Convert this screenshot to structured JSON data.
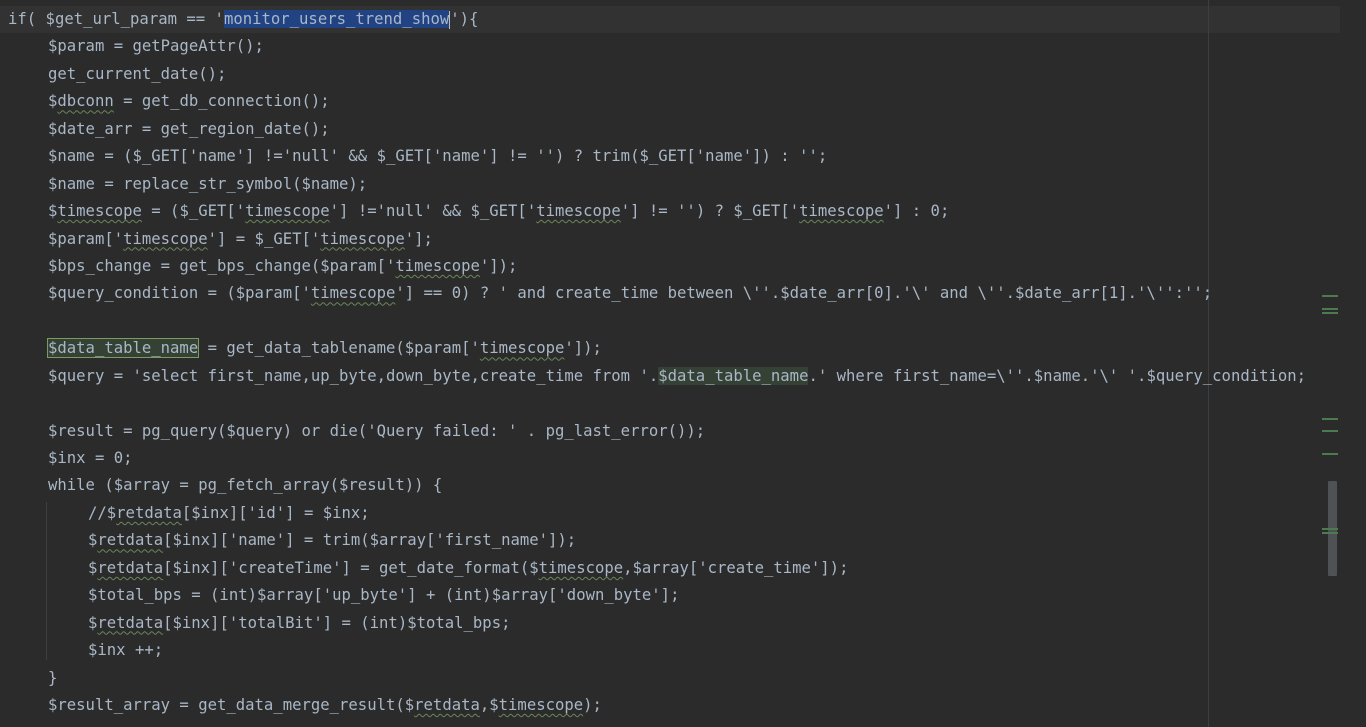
{
  "editor": {
    "lines": [
      {
        "pre": "if( $get_url_param == '",
        "selected": "monitor_users_trend_show",
        "post": "'){"
      },
      {
        "text": "$param = getPageAttr();"
      },
      {
        "text": "get_current_date();"
      },
      {
        "pre": "$",
        "squig": "dbconn",
        "post": " = get_db_connection();"
      },
      {
        "text": "$date_arr = get_region_date();"
      },
      {
        "text": "$name = ($_GET['name'] !='null' && $_GET['name'] != '') ? trim($_GET['name']) : '';"
      },
      {
        "text": "$name = replace_str_symbol($name);"
      },
      {
        "pre": "$",
        "squig": "timescope",
        "mid1": " = ($_GET['",
        "squig2": "timescope",
        "mid2": "'] !='null' && $_GET['",
        "squig3": "timescope",
        "mid3": "'] != '') ? $_GET['",
        "squig4": "timescope",
        "post": "'] : 0;"
      },
      {
        "pre": "$param['",
        "squig": "timescope",
        "mid1": "'] = $_GET['",
        "squig2": "timescope",
        "post": "'];"
      },
      {
        "pre": "$bps_change = get_bps_change($param['",
        "squig": "timescope",
        "post": "']);"
      },
      {
        "pre": "$query_condition = ($param['",
        "squig": "timescope",
        "post": "'] == 0) ? ' and create_time between \\''.$date_arr[0].'\\' and \\''.$date_arr[1].'\\'':'';"
      },
      {
        "text": ""
      },
      {
        "box": "$data_table_name",
        "pre": " = get_data_tablename($param['",
        "squig": "timescope",
        "post": "']);"
      },
      {
        "pre": "$query = 'select first_name,up_byte,down_byte,create_time from '.",
        "usage": "$data_table_name",
        "post": ".' where first_name=\\''.$name.'\\' '.$query_condition;"
      },
      {
        "text": ""
      },
      {
        "text": "$result = pg_query($query) or die('Query failed: ' . pg_last_error());"
      },
      {
        "text": "$inx = 0;"
      },
      {
        "text": "while ($array = pg_fetch_array($result)) {"
      },
      {
        "pre": "//$",
        "squig": "retdata",
        "post": "[$inx]['id'] = $inx;"
      },
      {
        "pre": "$",
        "squig": "retdata",
        "post": "[$inx]['name'] = trim($array['first_name']);"
      },
      {
        "pre": "$",
        "squig": "retdata",
        "mid1": "[$inx]['createTime'] = get_date_format($",
        "squig2": "timescope",
        "post": ",$array['create_time']);"
      },
      {
        "text": "$total_bps = (int)$array['up_byte'] + (int)$array['down_byte'];"
      },
      {
        "pre": "$",
        "squig": "retdata",
        "post": "[$inx]['totalBit'] = (int)$total_bps;"
      },
      {
        "text": "$inx ++;"
      },
      {
        "text": "}"
      },
      {
        "pre": "$result_array = get_data_merge_result($",
        "squig": "retdata",
        "mid1": ",$",
        "squig2": "timescope",
        "post": ");"
      }
    ]
  }
}
